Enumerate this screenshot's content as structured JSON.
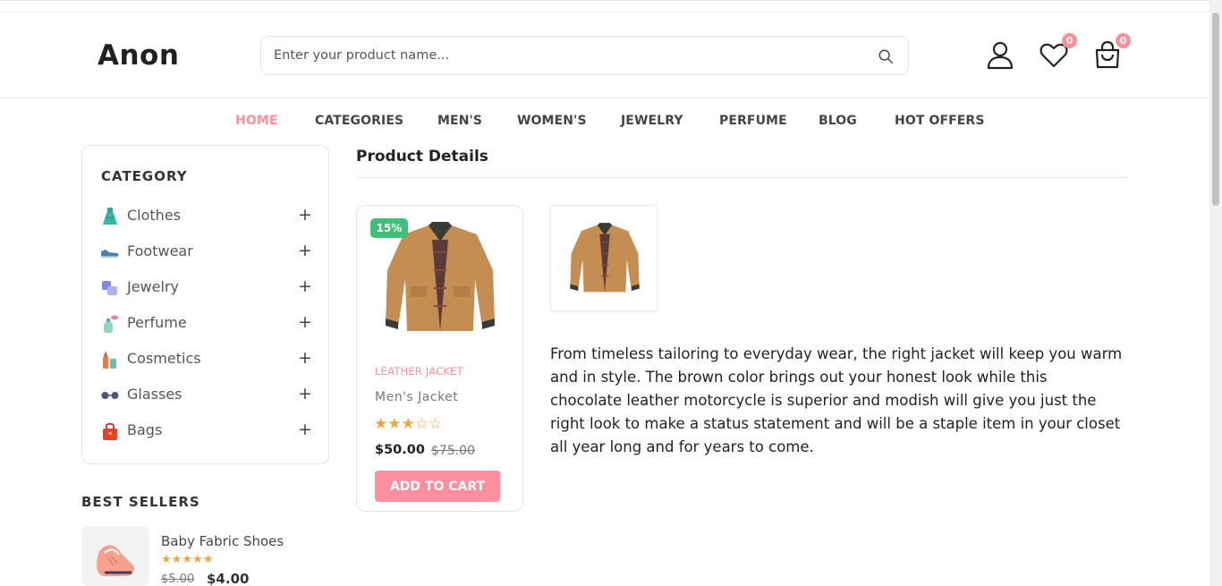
{
  "header": {
    "logo": "Anon",
    "search_placeholder": "Enter your product name...",
    "wishlist_count": "0",
    "cart_count": "0"
  },
  "nav": {
    "items": [
      "HOME",
      "CATEGORIES",
      "MEN'S",
      "WOMEN'S",
      "JEWELRY",
      "PERFUME",
      "BLOG",
      "HOT OFFERS"
    ],
    "active": "HOME"
  },
  "sidebar": {
    "title": "CATEGORY",
    "items": [
      {
        "label": "Clothes",
        "icon": "dress-icon"
      },
      {
        "label": "Footwear",
        "icon": "shoe-icon"
      },
      {
        "label": "Jewelry",
        "icon": "watch-icon"
      },
      {
        "label": "Perfume",
        "icon": "perfume-icon"
      },
      {
        "label": "Cosmetics",
        "icon": "cosmetics-icon"
      },
      {
        "label": "Glasses",
        "icon": "glasses-icon"
      },
      {
        "label": "Bags",
        "icon": "bag-icon"
      }
    ],
    "expand_symbol": "+"
  },
  "best_sellers": {
    "title": "BEST SELLERS",
    "items": [
      {
        "name": "Baby Fabric Shoes",
        "rating": 5,
        "old_price": "$5.00",
        "price": "$4.00"
      }
    ]
  },
  "product_details": {
    "title": "Product Details",
    "card": {
      "discount": "15%",
      "category": "LEATHER JACKET",
      "name": "Men's Jacket",
      "rating": 3,
      "rating_max": 5,
      "price": "$50.00",
      "old_price": "$75.00",
      "button": "ADD TO CART"
    },
    "description": "From timeless tailoring to everyday wear, the right jacket will keep you warm and in style. The brown color brings out your honest look while this chocolate leather motorcycle is superior and modish will give you just the right look to make a status statement and will be a staple item in your closet all year long and for years to come."
  },
  "colors": {
    "accent": "#ff8f9c",
    "badge_green": "#3fbf78",
    "star": "#f2a444"
  }
}
